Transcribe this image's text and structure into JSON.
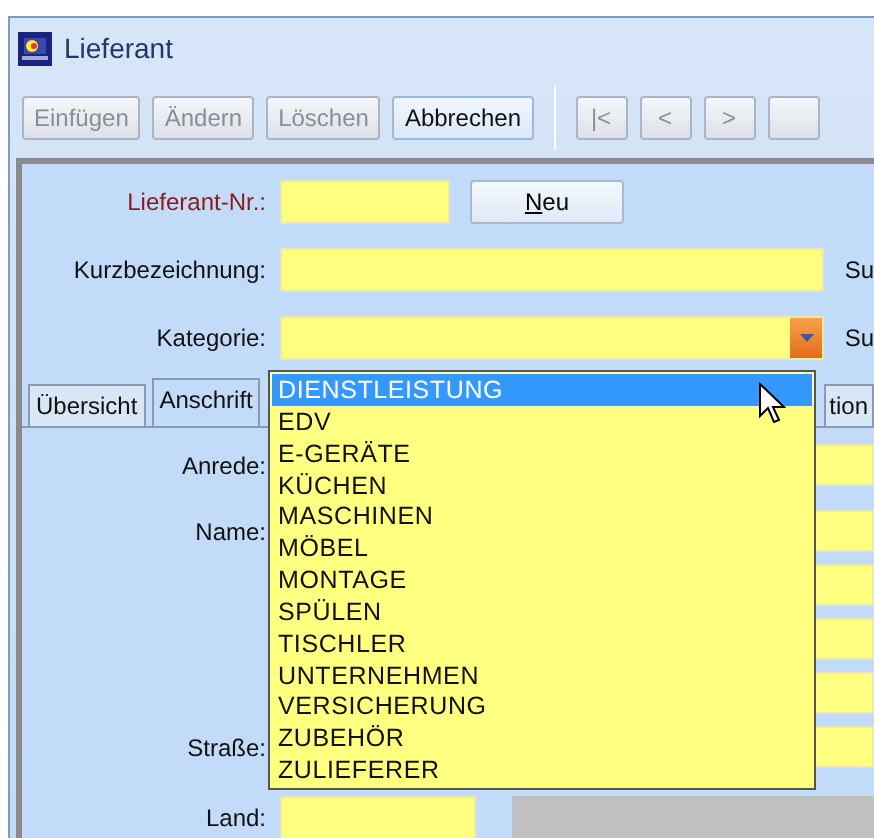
{
  "window": {
    "title": "Lieferant"
  },
  "toolbar": [
    {
      "label": "Einfügen",
      "disabled": true
    },
    {
      "label": "Ändern",
      "disabled": true
    },
    {
      "label": "Löschen",
      "disabled": true
    },
    {
      "label": "Abbrechen",
      "disabled": false
    }
  ],
  "navigation": [
    {
      "label": "|<",
      "disabled": true
    },
    {
      "label": "<",
      "disabled": true
    },
    {
      "label": ">",
      "disabled": true
    }
  ],
  "header_fields": [
    {
      "label": "Lieferant-Nr.:",
      "kind": "number",
      "button": "Neu"
    },
    {
      "label": "Kurzbezeichnung:",
      "kind": "text",
      "side_label": "Su"
    },
    {
      "label": "Kategorie:",
      "kind": "combo",
      "side_label": "Su"
    }
  ],
  "tabs": [
    {
      "label": "Übersicht",
      "selected": false
    },
    {
      "label": "Anschrift",
      "selected": true
    },
    {
      "label": "tion",
      "selected": false
    }
  ],
  "address_fields": [
    {
      "label": "Anrede:",
      "kind": "text"
    },
    {
      "label": "Name:",
      "kind": "text"
    },
    {
      "kind": "text"
    },
    {
      "kind": "text"
    },
    {
      "kind": "text"
    },
    {
      "label": "Straße:",
      "kind": "text"
    }
  ],
  "land_field": {
    "label": "Land:"
  },
  "category_dropdown": {
    "items": [
      {
        "label": "DIENSTLEISTUNG",
        "selected": true
      },
      {
        "label": "EDV",
        "selected": false
      },
      {
        "label": "E-GERÄTE",
        "selected": false
      },
      {
        "label": "KÜCHEN",
        "selected": false
      },
      {
        "label": "MASCHINEN",
        "selected": false
      },
      {
        "label": "MÖBEL",
        "selected": false
      },
      {
        "label": "MONTAGE",
        "selected": false
      },
      {
        "label": "SPÜLEN",
        "selected": false
      },
      {
        "label": "TISCHLER",
        "selected": false
      },
      {
        "label": "UNTERNEHMEN",
        "selected": false
      },
      {
        "label": "VERSICHERUNG",
        "selected": false
      },
      {
        "label": "ZUBEHÖR",
        "selected": false
      },
      {
        "label": "ZULIEFERER",
        "selected": false
      }
    ]
  }
}
